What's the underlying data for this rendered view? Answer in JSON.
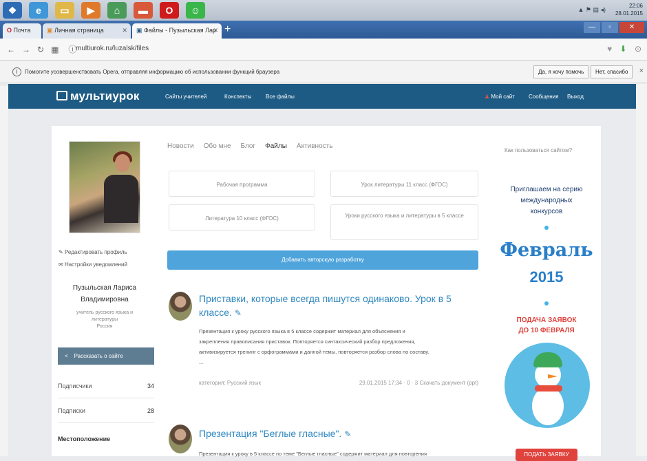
{
  "taskbar": {
    "icons": [
      {
        "name": "windows-start-icon",
        "color": "#2d6bb5",
        "glyph": "❖"
      },
      {
        "name": "internet-explorer-icon",
        "color": "#3f97d8",
        "glyph": "e"
      },
      {
        "name": "file-explorer-icon",
        "color": "#e0b84a",
        "glyph": "▭"
      },
      {
        "name": "media-player-icon",
        "color": "#e07a2a",
        "glyph": "▶"
      },
      {
        "name": "control-panel-icon",
        "color": "#4a9b5a",
        "glyph": "⌂"
      },
      {
        "name": "presentation-app-icon",
        "color": "#d8583a",
        "glyph": "▬"
      },
      {
        "name": "opera-browser-icon",
        "color": "#cf1b1b",
        "glyph": "O"
      },
      {
        "name": "chat-app-icon",
        "color": "#39b54a",
        "glyph": "☺"
      }
    ]
  },
  "browser": {
    "tabs": [
      {
        "label": "Почта",
        "active": false
      },
      {
        "label": "Личная страница",
        "active": false
      },
      {
        "label": "Файлы - Пузыльская Лар",
        "active": true
      }
    ],
    "new_tab": "+",
    "url": "multiurok.ru/luzalsk/files"
  },
  "infobar": {
    "text": "Помогите усовершенствовать Opera, отправляя информацию об использовании функций браузера",
    "accept_label": "Да, я хочу помочь",
    "decline_label": "Нет, спасибо",
    "close": "×"
  },
  "site": {
    "logo": "мультиурок",
    "nav": [
      "Сайты учителей",
      "Конспекты",
      "Все файлы"
    ],
    "user_nav": [
      "Мой сайт",
      "Сообщения",
      "Выход"
    ]
  },
  "profile": {
    "edit_link": "Редактировать профиль",
    "settings_link": "Настройки уведомлений",
    "name_line1": "Пузыльская Лариса",
    "name_line2": "Владимировна",
    "role_line1": "учитель русского языка и",
    "role_line2": "литературы",
    "role_line3": "Россия",
    "share_label": "Рассказать о сайте",
    "stats": [
      {
        "label": "Подписчики",
        "value": "34"
      },
      {
        "label": "Подписки",
        "value": "28"
      }
    ],
    "location_heading": "Местоположение"
  },
  "profile_tabs": [
    {
      "label": "Новости",
      "active": false
    },
    {
      "label": "Обо мне",
      "active": false
    },
    {
      "label": "Блог",
      "active": false
    },
    {
      "label": "Файлы",
      "active": true
    },
    {
      "label": "Активность",
      "active": false
    }
  ],
  "mini_cards": [
    {
      "text": "Рабочая программа"
    },
    {
      "text": "Урок литературы 11 класс (ФГОС)"
    },
    {
      "text": "Литература 10 класс (ФГОС)"
    },
    {
      "text": "Уроки русского языка и литературы в 5 классе"
    }
  ],
  "add_button": "Добавить авторскую разработку",
  "posts": [
    {
      "title": "Приставки, которые всегда пишутся одинаково. Урок в 5 классе.",
      "lines": [
        "Презентация к уроку русского языка в 5 классе содержит материал для объяснения и",
        "закрепления правописания приставок. Повторяется синтаксический разбор предложения,",
        "активизируется тренинг с орфограммами и данной темы, повторяется разбор слова по составу.",
        "..."
      ],
      "category": "категория: Русский язык",
      "meta_right": "29.01.2015 17:34 · 0 · 3 Скачать документ (ppt)"
    },
    {
      "title": "Презентация \"Беглые гласные\".",
      "lines": [
        "Презентация к уроку в 5 классе по теме \"Беглые гласные\" содержит материал для повторения"
      ]
    }
  ],
  "ad": {
    "question": "Как пользоваться сайтом?",
    "invite_line1": "Приглашаем на серию",
    "invite_line2": "международных",
    "invite_line3": "конкурсов",
    "month": "Февраль",
    "year": "2015",
    "deadline_line1": "ПОДАЧА ЗАЯВОК",
    "deadline_line2": "ДО 10 ФЕВРАЛЯ",
    "button": "ПОДАТЬ ЗАЯВКУ"
  }
}
